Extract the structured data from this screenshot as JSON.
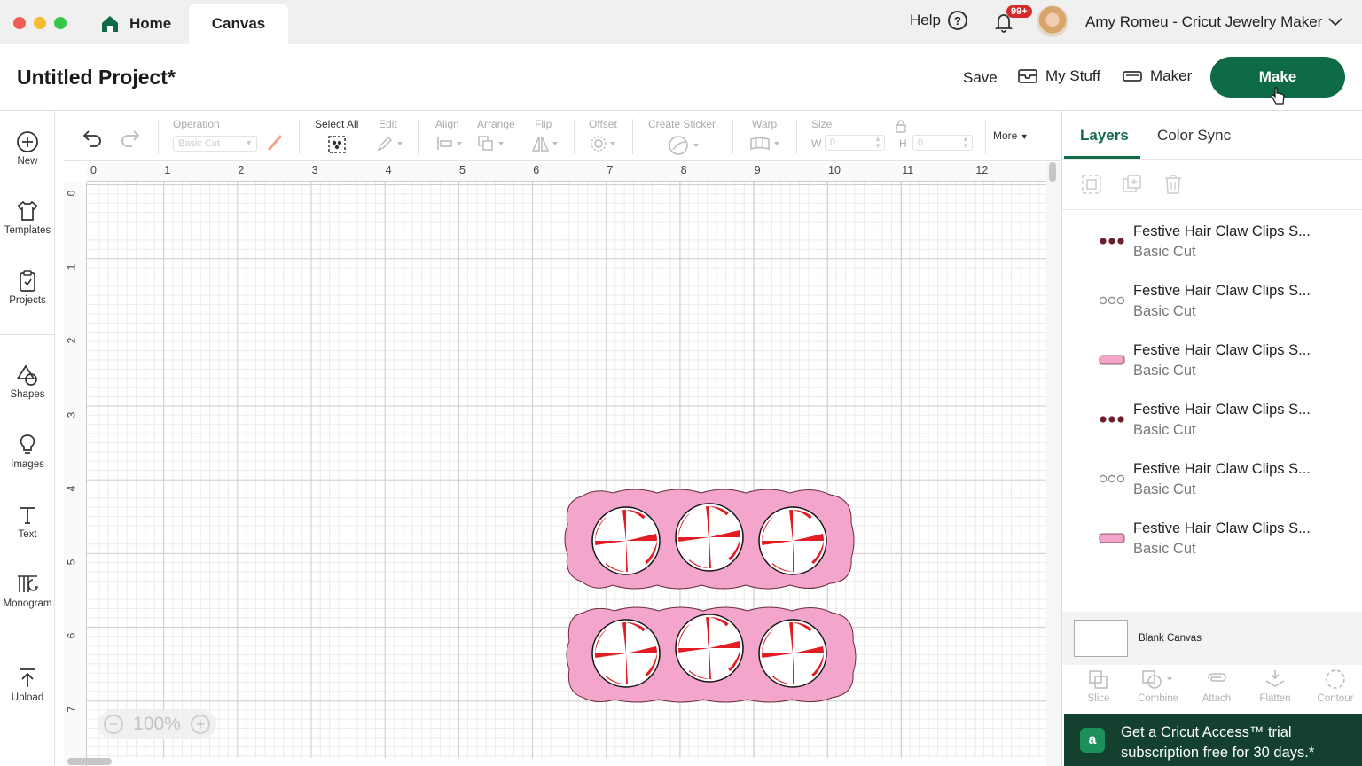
{
  "window": {
    "traffic_colors": [
      "#ee5e57",
      "#f6bc2f",
      "#35c64a"
    ]
  },
  "tabs": {
    "home": "Home",
    "canvas": "Canvas"
  },
  "topbar": {
    "help": "Help",
    "notification_badge": "99+",
    "user_name": "Amy Romeu - Cricut Jewelry Maker"
  },
  "header": {
    "project_title": "Untitled Project*",
    "save": "Save",
    "my_stuff": "My Stuff",
    "maker": "Maker",
    "make": "Make",
    "accent_color": "#0e6b46"
  },
  "sidebar": {
    "items": [
      {
        "label": "New",
        "icon": "plus-circle-icon"
      },
      {
        "label": "Templates",
        "icon": "shirt-icon"
      },
      {
        "label": "Projects",
        "icon": "clipboard-icon"
      },
      {
        "label": "Shapes",
        "icon": "shapes-icon"
      },
      {
        "label": "Images",
        "icon": "lightbulb-icon"
      },
      {
        "label": "Text",
        "icon": "text-icon"
      },
      {
        "label": "Monogram",
        "icon": "monogram-icon"
      },
      {
        "label": "Upload",
        "icon": "upload-icon"
      }
    ]
  },
  "toolbar": {
    "operation_label": "Operation",
    "operation_value": "Basic Cut",
    "select_all": "Select All",
    "edit": "Edit",
    "align": "Align",
    "arrange": "Arrange",
    "flip": "Flip",
    "offset": "Offset",
    "create_sticker": "Create Sticker",
    "warp": "Warp",
    "size": "Size",
    "w_label": "W",
    "h_label": "H",
    "w_value": "0",
    "h_value": "0",
    "more": "More"
  },
  "canvas": {
    "ruler_x": [
      "0",
      "1",
      "2",
      "3",
      "4",
      "5",
      "6",
      "7",
      "8",
      "9",
      "10",
      "11",
      "12"
    ],
    "ruler_y": [
      "0",
      "1",
      "2",
      "3",
      "4",
      "5",
      "6",
      "7"
    ],
    "zoom": "100%",
    "design_colors": {
      "clip_pink": "#f3a5cc",
      "peppermint_red": "#e31b23",
      "outline": "#6a2d3a"
    }
  },
  "panel": {
    "tab_layers": "Layers",
    "tab_color_sync": "Color Sync",
    "layers": [
      {
        "name": "Festive Hair Claw Clips S...",
        "op": "Basic Cut",
        "thumb": "dots-dark"
      },
      {
        "name": "Festive Hair Claw Clips S...",
        "op": "Basic Cut",
        "thumb": "dots-outline"
      },
      {
        "name": "Festive Hair Claw Clips S...",
        "op": "Basic Cut",
        "thumb": "pink-bar"
      },
      {
        "name": "Festive Hair Claw Clips S...",
        "op": "Basic Cut",
        "thumb": "dots-dark"
      },
      {
        "name": "Festive Hair Claw Clips S...",
        "op": "Basic Cut",
        "thumb": "dots-outline"
      },
      {
        "name": "Festive Hair Claw Clips S...",
        "op": "Basic Cut",
        "thumb": "pink-bar"
      }
    ],
    "blank_canvas": "Blank Canvas",
    "bottom_tools": [
      "Slice",
      "Combine",
      "Attach",
      "Flatten",
      "Contour"
    ],
    "promo": "Get a Cricut Access™ trial subscription free for 30 days.*",
    "promo_logo": "a"
  }
}
